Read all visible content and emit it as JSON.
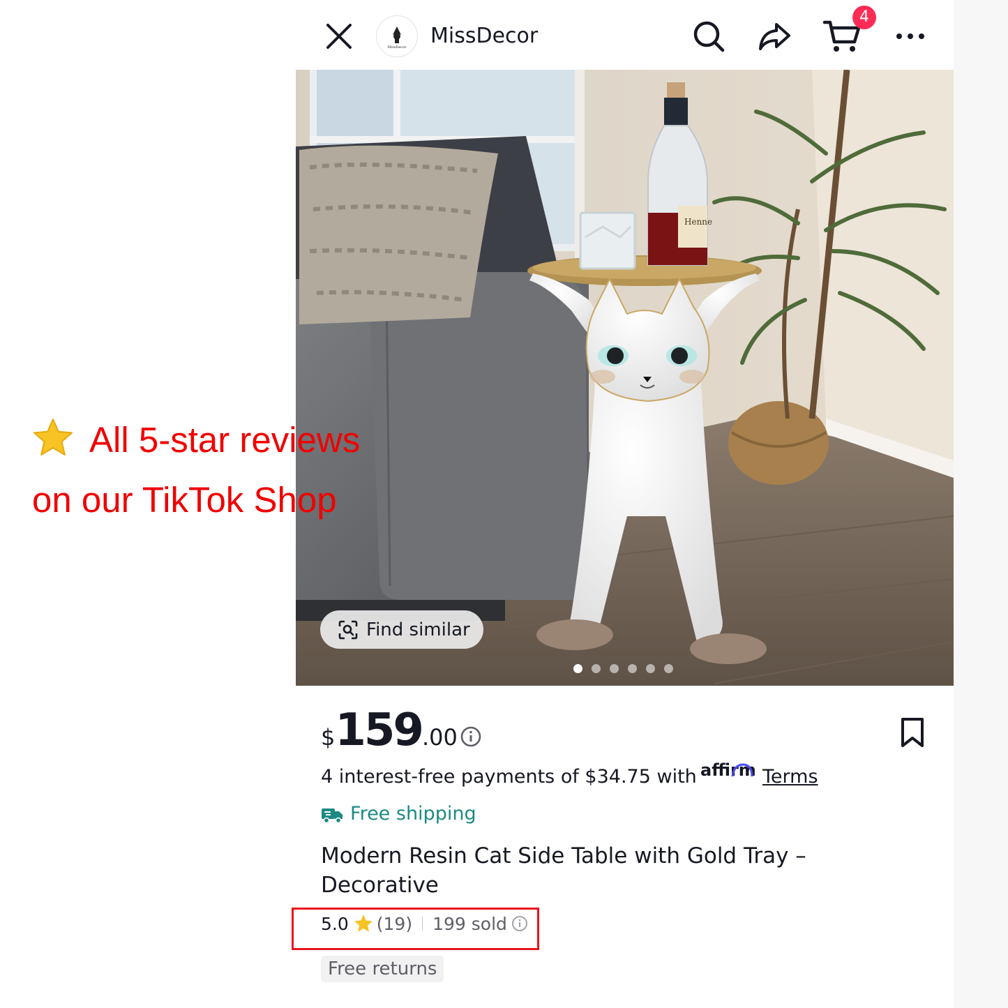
{
  "header": {
    "store_name": "MissDecor",
    "avatar_text": "MissDecor",
    "cart_count": "4"
  },
  "gallery": {
    "find_similar_label": "Find similar",
    "bottle_label": "Henne\nV.S.O",
    "image_count": 6,
    "active_index": 0
  },
  "product": {
    "price": {
      "currency": "$",
      "whole": "159",
      "cents": ".00"
    },
    "installments_text": "4 interest-free payments of $34.75 with",
    "affirm_label": "affirm",
    "terms_label": "Terms",
    "shipping_label": "Free shipping",
    "title": "Modern Resin Cat Side Table with Gold Tray – Decorative",
    "rating": "5.0",
    "review_count": "(19)",
    "sold": "199 sold",
    "returns_label": "Free returns"
  },
  "annotation": {
    "line1": "All 5-star reviews",
    "line2": "on our TikTok Shop"
  },
  "colors": {
    "accent_red": "#fe2c55",
    "shipping_teal": "#1c8a83",
    "annotation_red": "#f00000",
    "star_gold": "#f7c325"
  },
  "icons": [
    "close-icon",
    "search-icon",
    "share-icon",
    "cart-icon",
    "more-icon",
    "scan-icon",
    "info-icon",
    "bookmark-icon",
    "truck-icon",
    "star-icon"
  ]
}
